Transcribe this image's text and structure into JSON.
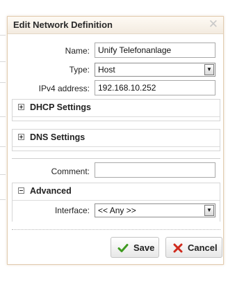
{
  "dialog": {
    "title": "Edit Network Definition",
    "close_icon": "close-x-icon"
  },
  "form": {
    "name": {
      "label": "Name:",
      "value": "Unify Telefonanlage"
    },
    "type": {
      "label": "Type:",
      "value": "Host"
    },
    "ipv4": {
      "label": "IPv4 address:",
      "value": "192.168.10.252"
    },
    "comment": {
      "label": "Comment:",
      "value": ""
    },
    "interface": {
      "label": "Interface:",
      "value": "<< Any >>"
    }
  },
  "sections": {
    "dhcp": {
      "title": "DHCP Settings",
      "state": "collapsed"
    },
    "dns": {
      "title": "DNS Settings",
      "state": "collapsed"
    },
    "advanced": {
      "title": "Advanced",
      "state": "expanded"
    }
  },
  "buttons": {
    "save": {
      "label": "Save",
      "icon": "checkmark-icon",
      "color": "#3e9a1f"
    },
    "cancel": {
      "label": "Cancel",
      "icon": "x-cross-icon",
      "color": "#cf2a1d"
    }
  }
}
